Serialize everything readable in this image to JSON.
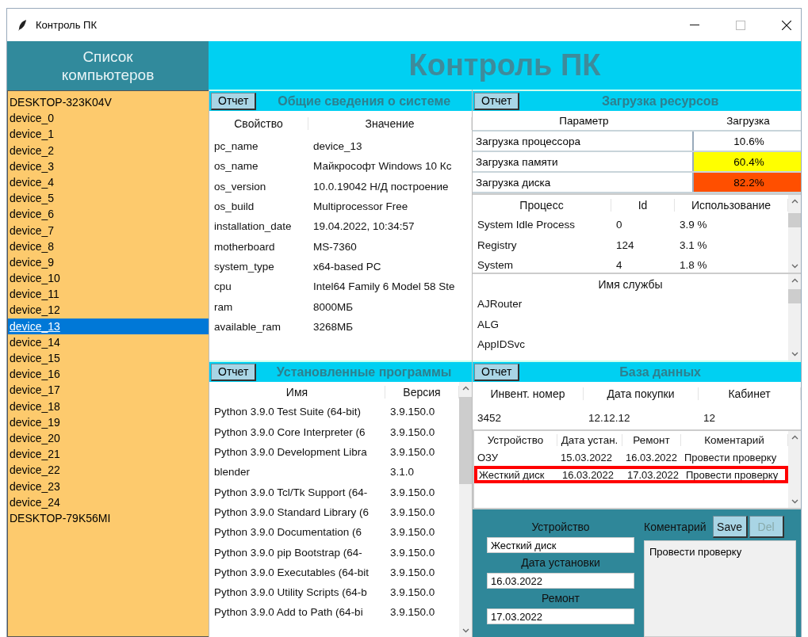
{
  "window": {
    "title": "Контроль ПК"
  },
  "sidebar": {
    "title": "Список компьютеров",
    "items": [
      {
        "label": "DESKTOP-323K04V",
        "selected": false
      },
      {
        "label": "device_0",
        "selected": false
      },
      {
        "label": "device_1",
        "selected": false
      },
      {
        "label": "device_2",
        "selected": false
      },
      {
        "label": "device_3",
        "selected": false
      },
      {
        "label": "device_4",
        "selected": false
      },
      {
        "label": "device_5",
        "selected": false
      },
      {
        "label": "device_6",
        "selected": false
      },
      {
        "label": "device_7",
        "selected": false
      },
      {
        "label": "device_8",
        "selected": false
      },
      {
        "label": "device_9",
        "selected": false
      },
      {
        "label": "device_10",
        "selected": false
      },
      {
        "label": "device_11",
        "selected": false
      },
      {
        "label": "device_12",
        "selected": false
      },
      {
        "label": "device_13",
        "selected": true
      },
      {
        "label": "device_14",
        "selected": false
      },
      {
        "label": "device_15",
        "selected": false
      },
      {
        "label": "device_16",
        "selected": false
      },
      {
        "label": "device_17",
        "selected": false
      },
      {
        "label": "device_18",
        "selected": false
      },
      {
        "label": "device_19",
        "selected": false
      },
      {
        "label": "device_20",
        "selected": false
      },
      {
        "label": "device_21",
        "selected": false
      },
      {
        "label": "device_22",
        "selected": false
      },
      {
        "label": "device_23",
        "selected": false
      },
      {
        "label": "device_24",
        "selected": false
      },
      {
        "label": "DESKTOP-79K56MI",
        "selected": false
      }
    ]
  },
  "header": {
    "title": "Контроль ПК"
  },
  "system_panel": {
    "button": "Отчет",
    "title": "Общие сведения о системе",
    "columns": [
      "Свойство",
      "Значение"
    ],
    "rows": [
      [
        "pc_name",
        "device_13"
      ],
      [
        "os_name",
        "Майкрософт Windows 10 Кс"
      ],
      [
        "os_version",
        "10.0.19042 Н/Д построение"
      ],
      [
        "os_build",
        "Multiprocessor Free"
      ],
      [
        "installation_date",
        "19.04.2022, 10:34:57"
      ],
      [
        "motherboard",
        "MS-7360"
      ],
      [
        "system_type",
        "x64-based PC"
      ],
      [
        "cpu",
        "Intel64 Family 6 Model 58 Ste"
      ],
      [
        "ram",
        "8000МБ"
      ],
      [
        "available_ram",
        "3268МБ"
      ]
    ]
  },
  "resources_panel": {
    "button": "Отчет",
    "title": "Загрузка ресурсов",
    "columns": [
      "Параметр",
      "Загрузка"
    ],
    "rows": [
      {
        "parameter": "Загрузка процессора",
        "value": "10.6%",
        "color": "#ffffff"
      },
      {
        "parameter": "Загрузка памяти",
        "value": "60.4%",
        "color": "#ffff00"
      },
      {
        "parameter": "Загрузка диска",
        "value": "82.2%",
        "color": "#ff4f00"
      }
    ],
    "processes": {
      "columns": [
        "Процесс",
        "Id",
        "Использование"
      ],
      "rows": [
        [
          "System Idle Process",
          "0",
          "3.9 %"
        ],
        [
          "Registry",
          "124",
          "3.1 %"
        ],
        [
          "System",
          "4",
          "1.8 %"
        ]
      ]
    },
    "services": {
      "columns": [
        "Имя службы"
      ],
      "rows": [
        "AJRouter",
        "ALG",
        "AppIDSvc"
      ]
    }
  },
  "programs_panel": {
    "button": "Отчет",
    "title": "Установленные программы",
    "columns": [
      "Имя",
      "Версия"
    ],
    "rows": [
      [
        "Python 3.9.0 Test Suite (64-bit)",
        "3.9.150.0"
      ],
      [
        "Python 3.9.0 Core Interpreter (6",
        "3.9.150.0"
      ],
      [
        "Python 3.9.0 Development Libra",
        "3.9.150.0"
      ],
      [
        "blender",
        "3.1.0"
      ],
      [
        "Python 3.9.0 Tcl/Tk Support (64-",
        "3.9.150.0"
      ],
      [
        "Python 3.9.0 Standard Library (6",
        "3.9.150.0"
      ],
      [
        "Python 3.9.0 Documentation (6",
        "3.9.150.0"
      ],
      [
        "Python 3.9.0 pip Bootstrap (64-",
        "3.9.150.0"
      ],
      [
        "Python 3.9.0 Executables (64-bit",
        "3.9.150.0"
      ],
      [
        "Python 3.9.0 Utility Scripts (64-b",
        "3.9.150.0"
      ],
      [
        "Python 3.9.0 Add to Path (64-bi",
        "3.9.150.0"
      ]
    ]
  },
  "database_panel": {
    "button": "Отчет",
    "title": "База данных",
    "info": {
      "columns": [
        "Инвент. номер",
        "Дата покупки",
        "Кабинет"
      ],
      "rows": [
        [
          "3452",
          "12.12.12",
          "12"
        ]
      ]
    },
    "devices": {
      "columns": [
        "Устройство",
        "Дата устан.",
        "Ремонт",
        "Коментарий"
      ],
      "rows": [
        {
          "cells": [
            "ОЗУ",
            "15.03.2022",
            "16.03.2022",
            "Провести проверку"
          ],
          "selected": false
        },
        {
          "cells": [
            "Жесткий диск",
            "16.03.2022",
            "17.03.2022",
            "Провести проверку"
          ],
          "selected": true
        }
      ]
    },
    "form": {
      "fields": [
        {
          "label": "Устройство",
          "value": "Жесткий диск"
        },
        {
          "label": "Дата установки",
          "value": "16.03.2022"
        },
        {
          "label": "Ремонт",
          "value": "17.03.2022"
        }
      ],
      "comment": {
        "label": "Коментарий",
        "value": "Провести проверку"
      },
      "buttons": [
        {
          "label": "Save",
          "disabled": false
        },
        {
          "label": "Del",
          "disabled": true
        }
      ]
    }
  }
}
